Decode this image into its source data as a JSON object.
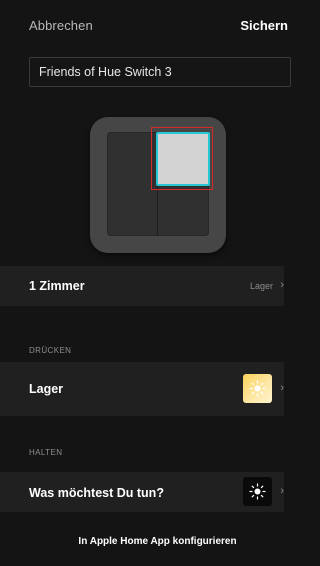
{
  "topbar": {
    "cancel_label": "Abbrechen",
    "save_label": "Sichern"
  },
  "name_field": {
    "value": "Friends of Hue Switch 3"
  },
  "rooms_row": {
    "label": "1 Zimmer",
    "value": "Lager"
  },
  "press_section": {
    "header": "DRÜCKEN",
    "action_label": "Lager",
    "tile_icon": "sun-icon",
    "tile_color": "#ffd25a"
  },
  "hold_section": {
    "header": "HALTEN",
    "action_label": "Was möchtest Du tun?",
    "tile_icon": "sun-icon",
    "tile_color": "#0a0a0a"
  },
  "footer": {
    "home_app_link": "In Apple Home App konfigurieren"
  },
  "colors": {
    "background": "#141414",
    "row_background": "#202020",
    "highlight": "#27c7d4",
    "selection": "#d32a2a"
  }
}
